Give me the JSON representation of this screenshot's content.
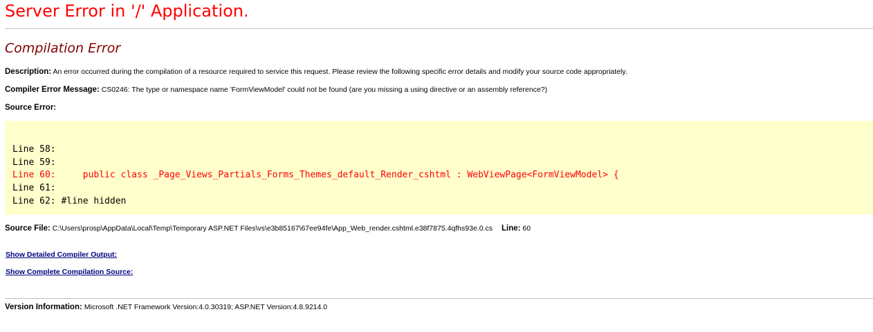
{
  "page_title": "Server Error in '/' Application.",
  "section_title": "Compilation Error",
  "description": {
    "label": "Description:",
    "text": "An error occurred during the compilation of a resource required to service this request. Please review the following specific error details and modify your source code appropriately."
  },
  "compiler_message": {
    "label": "Compiler Error Message:",
    "text": "CS0246: The type or namespace name 'FormViewModel' could not be found (are you missing a using directive or an assembly reference?)"
  },
  "source_error_label": "Source Error:",
  "source_lines": [
    {
      "text": "Line 58:",
      "highlight": false
    },
    {
      "text": "Line 59:",
      "highlight": false
    },
    {
      "text": "Line 60:     public class _Page_Views_Partials_Forms_Themes_default_Render_cshtml : WebViewPage<FormViewModel> {",
      "highlight": true
    },
    {
      "text": "Line 61:",
      "highlight": false
    },
    {
      "text": "Line 62: #line hidden",
      "highlight": false
    }
  ],
  "source_file": {
    "label": "Source File:",
    "path": "C:\\Users\\prosp\\AppData\\Local\\Temp\\Temporary ASP.NET Files\\vs\\e3b85167\\67ee94fe\\App_Web_render.cshtml.e38f7875.4qfhs93e.0.cs",
    "line_label": "Line:",
    "line_value": "60"
  },
  "links": {
    "detailed_output": "Show Detailed Compiler Output:",
    "complete_source": "Show Complete Compilation Source:"
  },
  "version": {
    "label": "Version Information:",
    "text": "Microsoft .NET Framework Version:4.0.30319; ASP.NET Version:4.8.9214.0"
  },
  "colors": {
    "title": "#ff0000",
    "subtitle": "#800000",
    "code_background": "#ffffcc",
    "highlight_line": "#ff0000",
    "link": "#000080"
  }
}
